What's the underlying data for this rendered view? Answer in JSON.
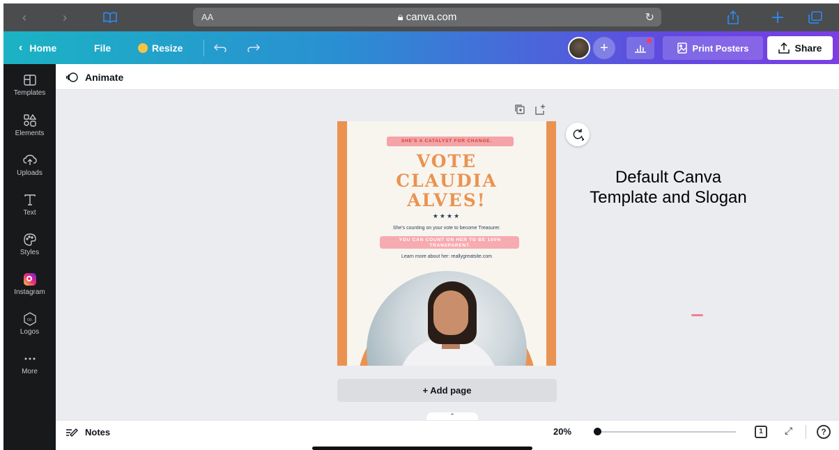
{
  "browser": {
    "address": "canva.com",
    "text_size_label": "AA",
    "reload_glyph": "↻",
    "lock_icon": "lock-icon"
  },
  "topbar": {
    "home_label": "Home",
    "file_label": "File",
    "resize_label": "Resize",
    "print_label": "Print Posters",
    "share_label": "Share",
    "add_collaborator": "+"
  },
  "sidebar": {
    "items": [
      {
        "label": "Templates",
        "icon": "templates-icon"
      },
      {
        "label": "Elements",
        "icon": "elements-icon"
      },
      {
        "label": "Uploads",
        "icon": "uploads-icon"
      },
      {
        "label": "Text",
        "icon": "text-icon"
      },
      {
        "label": "Styles",
        "icon": "styles-icon"
      },
      {
        "label": "Instagram",
        "icon": "instagram-icon"
      },
      {
        "label": "Logos",
        "icon": "logos-icon"
      },
      {
        "label": "More",
        "icon": "more-icon"
      }
    ]
  },
  "editor": {
    "animate_label": "Animate",
    "add_page_label": "+ Add page",
    "notes_label": "Notes",
    "zoom_label": "20%",
    "zoom_fraction": 0.0,
    "page_count": "1",
    "help_label": "?"
  },
  "poster": {
    "tagline": "SHE'S A CATALYST FOR CHANGE.",
    "headline_1": "VOTE",
    "headline_2": "CLAUDIA",
    "headline_3": "ALVES!",
    "stars": "★★★★",
    "counting": "She's counting on your vote to become Treasurer.",
    "transparent": "YOU CAN COUNT ON HER TO BE 100% TRANSPARENT.",
    "learn_more": "Learn more about her: reallygreatsite.com"
  },
  "annotation": {
    "text": "Default Canva Template and Slogan"
  },
  "colors": {
    "poster_orange": "#ea9351",
    "highlight_pink": "#f5a3a8",
    "canvas_bg": "#ebecf0",
    "sidebar_bg": "#18191b"
  }
}
